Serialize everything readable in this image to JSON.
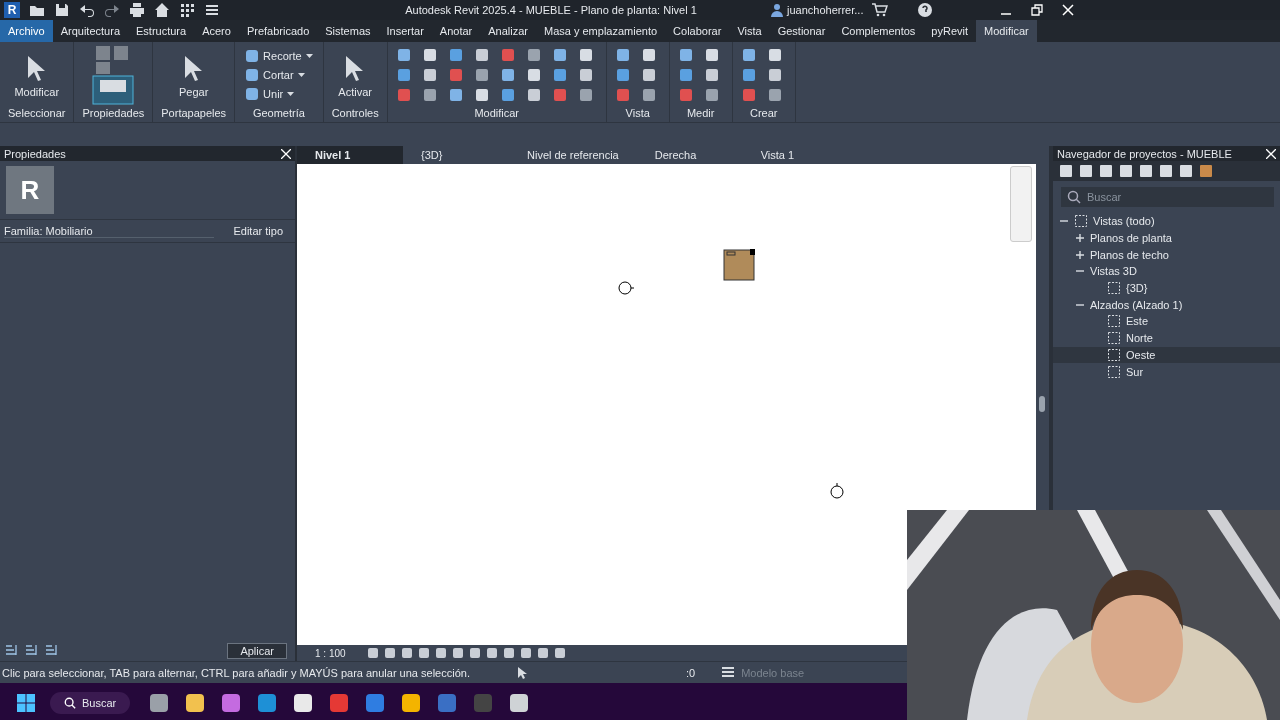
{
  "title_bar": {
    "logo": "R",
    "title": "Autodesk Revit 2025.4 - MUEBLE - Plano de planta: Nivel 1",
    "user": "juanchoherrer..."
  },
  "ribbon": {
    "tabs": [
      {
        "label": "Archivo",
        "selected": false,
        "kind": "file"
      },
      {
        "label": "Arquitectura",
        "selected": false,
        "kind": "tab"
      },
      {
        "label": "Estructura",
        "selected": false,
        "kind": "tab"
      },
      {
        "label": "Acero",
        "selected": false,
        "kind": "tab"
      },
      {
        "label": "Prefabricado",
        "selected": false,
        "kind": "tab"
      },
      {
        "label": "Sistemas",
        "selected": false,
        "kind": "tab"
      },
      {
        "label": "Insertar",
        "selected": false,
        "kind": "tab"
      },
      {
        "label": "Anotar",
        "selected": false,
        "kind": "tab"
      },
      {
        "label": "Analizar",
        "selected": false,
        "kind": "tab"
      },
      {
        "label": "Masa y emplazamiento",
        "selected": false,
        "kind": "tab"
      },
      {
        "label": "Colaborar",
        "selected": false,
        "kind": "tab"
      },
      {
        "label": "Vista",
        "selected": false,
        "kind": "tab"
      },
      {
        "label": "Gestionar",
        "selected": false,
        "kind": "tab"
      },
      {
        "label": "Complementos",
        "selected": false,
        "kind": "tab"
      },
      {
        "label": "pyRevit",
        "selected": false,
        "kind": "tab"
      },
      {
        "label": "Modificar",
        "selected": true,
        "kind": "tab"
      }
    ],
    "panels": [
      {
        "label": "Seleccionar",
        "kind": "large",
        "tools": [
          "Modificar"
        ]
      },
      {
        "label": "Propiedades",
        "kind": "props"
      },
      {
        "label": "Portapapeles",
        "kind": "large",
        "tools": [
          "Pegar"
        ]
      },
      {
        "label": "Geometría",
        "kind": "stack",
        "tools": [
          "Recorte",
          "Cortar",
          "Unir"
        ]
      },
      {
        "label": "Controles",
        "kind": "large",
        "tools": [
          "Activar"
        ]
      },
      {
        "label": "Modificar",
        "kind": "grid-wide"
      },
      {
        "label": "Vista",
        "kind": "grid-small"
      },
      {
        "label": "Medir",
        "kind": "grid-small"
      },
      {
        "label": "Crear",
        "kind": "grid-small"
      }
    ]
  },
  "properties": {
    "title": "Propiedades",
    "type_logo": "R",
    "family": "Familia: Mobiliario",
    "edit_type": "Editar tipo",
    "apply": "Aplicar"
  },
  "view_tabs": [
    {
      "label": "Nivel 1",
      "selected": true
    },
    {
      "label": "{3D}",
      "selected": false
    },
    {
      "label": "Nivel de referencia",
      "selected": false
    },
    {
      "label": "Derecha",
      "selected": false
    },
    {
      "label": "Vista 1",
      "selected": false
    }
  ],
  "view": {
    "scale": "1 : 100"
  },
  "project_browser": {
    "title": "Navegador de proyectos - MUEBLE",
    "search_placeholder": "Buscar",
    "tree": [
      {
        "label": "Vistas (todo)",
        "kind": "root",
        "expanded": true,
        "selected": false,
        "children": [
          {
            "label": "Planos de planta",
            "kind": "group",
            "expanded": false,
            "selected": false
          },
          {
            "label": "Planos de techo",
            "kind": "group",
            "expanded": false,
            "selected": false
          },
          {
            "label": "Vistas 3D",
            "kind": "group",
            "expanded": true,
            "selected": false,
            "children": [
              {
                "label": "{3D}",
                "kind": "view",
                "selected": false
              }
            ]
          },
          {
            "label": "Alzados (Alzado 1)",
            "kind": "group",
            "expanded": true,
            "selected": false,
            "children": [
              {
                "label": "Este",
                "kind": "view",
                "selected": false
              },
              {
                "label": "Norte",
                "kind": "view",
                "selected": false
              },
              {
                "label": "Oeste",
                "kind": "view",
                "selected": true
              },
              {
                "label": "Sur",
                "kind": "view",
                "selected": false
              }
            ]
          }
        ]
      }
    ]
  },
  "status_bar": {
    "message": "Clic para seleccionar, TAB para alternar, CTRL para añadir y MAYÚS para anular una selección.",
    "count": ":0",
    "model": "Modelo base"
  },
  "taskbar": {
    "search": "Buscar"
  }
}
